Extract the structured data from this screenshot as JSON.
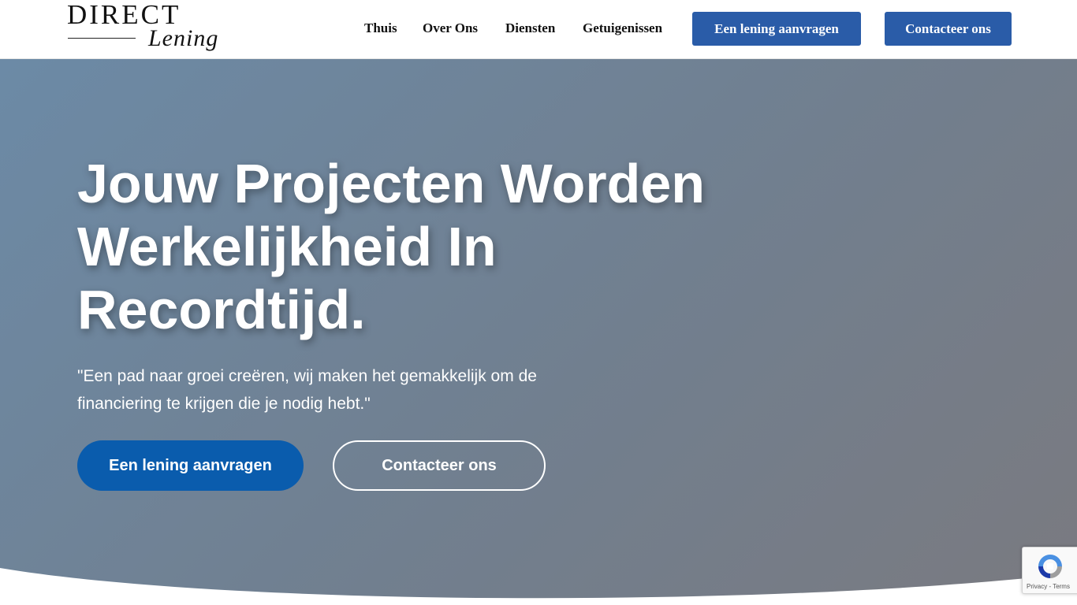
{
  "logo": {
    "top": "DIRECT",
    "bottom": "Lening"
  },
  "nav": {
    "links": [
      "Thuis",
      "Over Ons",
      "Diensten",
      "Getuigenissen"
    ],
    "apply_button": "Een lening aanvragen",
    "contact_button": "Contacteer ons"
  },
  "hero": {
    "title": "Jouw Projecten Worden Werkelijkheid In Recordtijd.",
    "subtitle": "\"Een pad naar groei creëren, wij maken het gemakkelijk om de financiering te krijgen die je nodig hebt.\"",
    "primary_button": "Een lening aanvragen",
    "secondary_button": "Contacteer ons"
  },
  "recaptcha": {
    "links": "Privacy - Terms"
  },
  "colors": {
    "accent": "#2a5ca8",
    "hero_button": "#0a5cad",
    "hero_gradient_start": "#6c8aa6",
    "hero_gradient_end": "#7a7a80"
  }
}
